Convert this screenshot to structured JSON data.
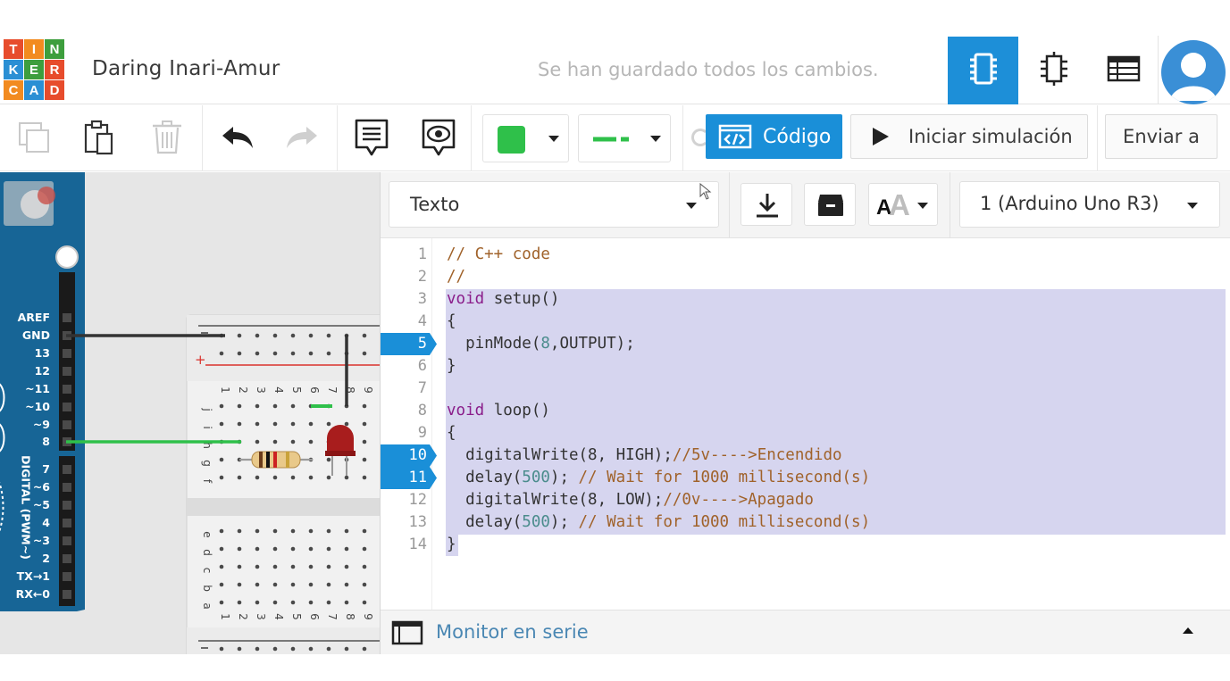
{
  "header": {
    "logo_letters": [
      "T",
      "I",
      "N",
      "K",
      "E",
      "R",
      "C",
      "A",
      "D"
    ],
    "logo_colors": [
      "#e74c2c",
      "#f28b20",
      "#3d9e3d",
      "#2b8fd4",
      "#3d9e3d",
      "#e74c2c",
      "#f28b20",
      "#2b8fd4",
      "#e74c2c"
    ],
    "project_title": "Daring Inari-Amur",
    "save_status": "Se han guardado todos los cambios.",
    "view_buttons": [
      "circuit-view-icon",
      "schematic-view-icon",
      "components-list-icon"
    ],
    "accent_color": "#1d8fd8"
  },
  "toolbar": {
    "tools": [
      "copy-icon",
      "paste-icon",
      "delete-icon",
      "undo-icon",
      "redo-icon",
      "notes-icon",
      "visibility-icon"
    ],
    "color_swatch": "#2fc04a",
    "wire_color": "#2fc04a",
    "code_label": "Código",
    "simulate_label": "Iniciar simulación",
    "send_label": "Enviar a"
  },
  "code_panel": {
    "mode_select": "Texto",
    "board_select": "1 (Arduino Uno R3)",
    "breakpoints": [
      5,
      10,
      11
    ],
    "lines": [
      {
        "n": "1",
        "tokens": [
          [
            "c",
            "// C++ code"
          ]
        ]
      },
      {
        "n": "2",
        "tokens": [
          [
            "c",
            "//"
          ]
        ]
      },
      {
        "n": "3",
        "tokens": [
          [
            "k",
            "void"
          ],
          [
            "p",
            " setup()"
          ]
        ]
      },
      {
        "n": "4",
        "tokens": [
          [
            "p",
            "{"
          ]
        ]
      },
      {
        "n": "5",
        "tokens": [
          [
            "p",
            "  pinMode("
          ],
          [
            "n",
            "8"
          ],
          [
            "p",
            ",OUTPUT);"
          ]
        ]
      },
      {
        "n": "6",
        "tokens": [
          [
            "p",
            "}"
          ]
        ]
      },
      {
        "n": "7",
        "tokens": []
      },
      {
        "n": "8",
        "tokens": [
          [
            "k",
            "void"
          ],
          [
            "p",
            " loop()"
          ]
        ]
      },
      {
        "n": "9",
        "tokens": [
          [
            "p",
            "{"
          ]
        ]
      },
      {
        "n": "10",
        "tokens": [
          [
            "p",
            "  digitalWrite(8, HIGH);"
          ],
          [
            "c",
            "//5v---->Encendido"
          ]
        ]
      },
      {
        "n": "11",
        "tokens": [
          [
            "p",
            "  delay("
          ],
          [
            "n",
            "500"
          ],
          [
            "p",
            "); "
          ],
          [
            "c",
            "// Wait for 1000 millisecond(s)"
          ]
        ]
      },
      {
        "n": "12",
        "tokens": [
          [
            "p",
            "  digitalWrite(8, LOW);"
          ],
          [
            "c",
            "//0v---->Apagado"
          ]
        ]
      },
      {
        "n": "13",
        "tokens": [
          [
            "p",
            "  delay("
          ],
          [
            "n",
            "500"
          ],
          [
            "p",
            "); "
          ],
          [
            "c",
            "// Wait for 1000 millisecond(s)"
          ]
        ]
      },
      {
        "n": "14",
        "tokens": [
          [
            "p",
            "}"
          ]
        ]
      }
    ],
    "serial_monitor_label": "Monitor en serie"
  },
  "arduino": {
    "pins": [
      "AREF",
      "GND",
      "13",
      "12",
      "~11",
      "~10",
      "~9",
      "8",
      "7",
      "~6",
      "~5",
      "4",
      "~3",
      "2",
      "TX→1",
      "RX←0"
    ],
    "digital_label": "DIGITAL (PWM~)"
  },
  "breadboard": {
    "col_numbers": [
      "1",
      "2",
      "3",
      "4",
      "5",
      "6",
      "7",
      "8",
      "9"
    ],
    "row_letters_top": [
      "j",
      "i",
      "h",
      "g",
      "f"
    ],
    "row_letters_bottom": [
      "e",
      "d",
      "c",
      "b",
      "a"
    ]
  }
}
